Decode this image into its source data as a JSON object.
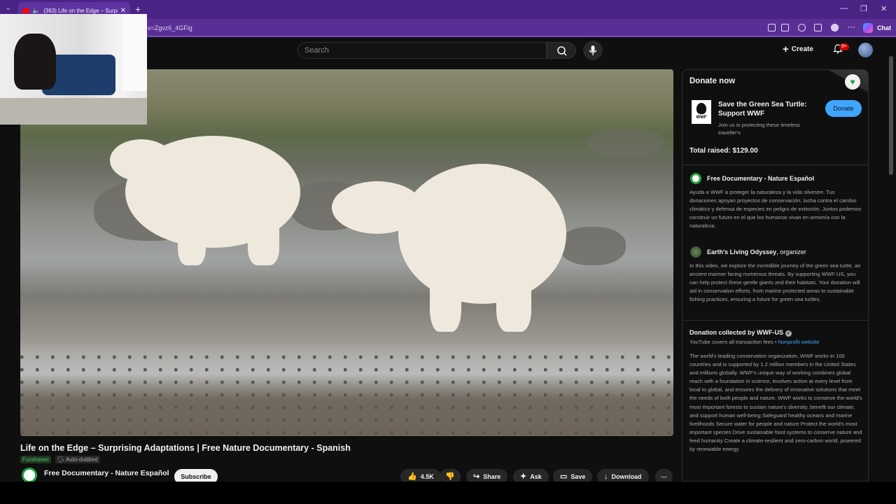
{
  "browser": {
    "tab_title": "(363) Life on the Edge – Surpr",
    "url": "v=Zgvz6_4GFig",
    "chat_label": "Chat"
  },
  "header": {
    "search_placeholder": "Search",
    "create_label": "Create",
    "notification_count": "9+"
  },
  "video": {
    "title": "Life on the Edge – Surprising Adaptations | Free Nature Documentary - Spanish",
    "fundraiser_label": "Fundraiser",
    "auto_dubbed_label": "Auto-dubbed",
    "channel_name": "Free Documentary - Nature Español",
    "subscribe_label": "Subscribe",
    "like_count": "4.5K",
    "share_label": "Share",
    "ask_label": "Ask",
    "save_label": "Save",
    "download_label": "Download"
  },
  "donate_panel": {
    "heading": "Donate now",
    "wwf_logo": "WWF",
    "campaign_title": "Save the Green Sea Turtle: Support WWF",
    "campaign_subtitle": "Join us in protecting these timeless traveller's",
    "donate_button": "Donate",
    "total_raised": "Total raised: $129.00",
    "org1_name": "Free Documentary - Nature Español",
    "org1_text": "Ayuda a WWF a proteger la naturaleza y la vida silvestre. Tus donaciones apoyan proyectos de conservación, lucha contra el cambio climático y defensa de especies en peligro de extinción. Juntos podemos construir un futuro en el que los humanos vivan en armonía con la naturaleza.",
    "org2_name": "Earth's Living Odyssey",
    "org2_role": ", organizer",
    "org2_text": "In this video, we explore the incredible journey of the green sea turtle, an ancient mariner facing numerous threats. By supporting WWF-US, you can help protect these gentle giants and their habitats. Your donation will aid in conservation efforts, from marine protected areas to sustainable fishing practices, ensuring a future for green sea turtles.",
    "collected_by": "Donation collected by WWF-US",
    "covers_text": "YouTube covers all transaction fees",
    "bullet": "•",
    "nonprofit_link": "Nonprofit website",
    "wwf_description": "The world's leading conservation organization, WWF works in 100 countries and is supported by 1.2 million members in the United States and millions globally. WWF's unique way of working combines global reach with a foundation in science, involves action at every level from local to global, and ensures the delivery of innovative solutions that meet the needs of both people and nature. WWF works to conserve the world's most important forests to sustain nature's diversity, benefit our climate, and support human well-being Safeguard healthy oceans and marine livelihoods Secure water for people and nature Protect the world's most important species Drive sustainable food systems to conserve nature and feed humanity Create a climate-resilient and zero-carbon world, powered by renewable energy"
  },
  "colors": {
    "browser_chrome": "#5a2f95",
    "accent_blue": "#3ea6ff",
    "fundraiser_green": "#43c463"
  }
}
